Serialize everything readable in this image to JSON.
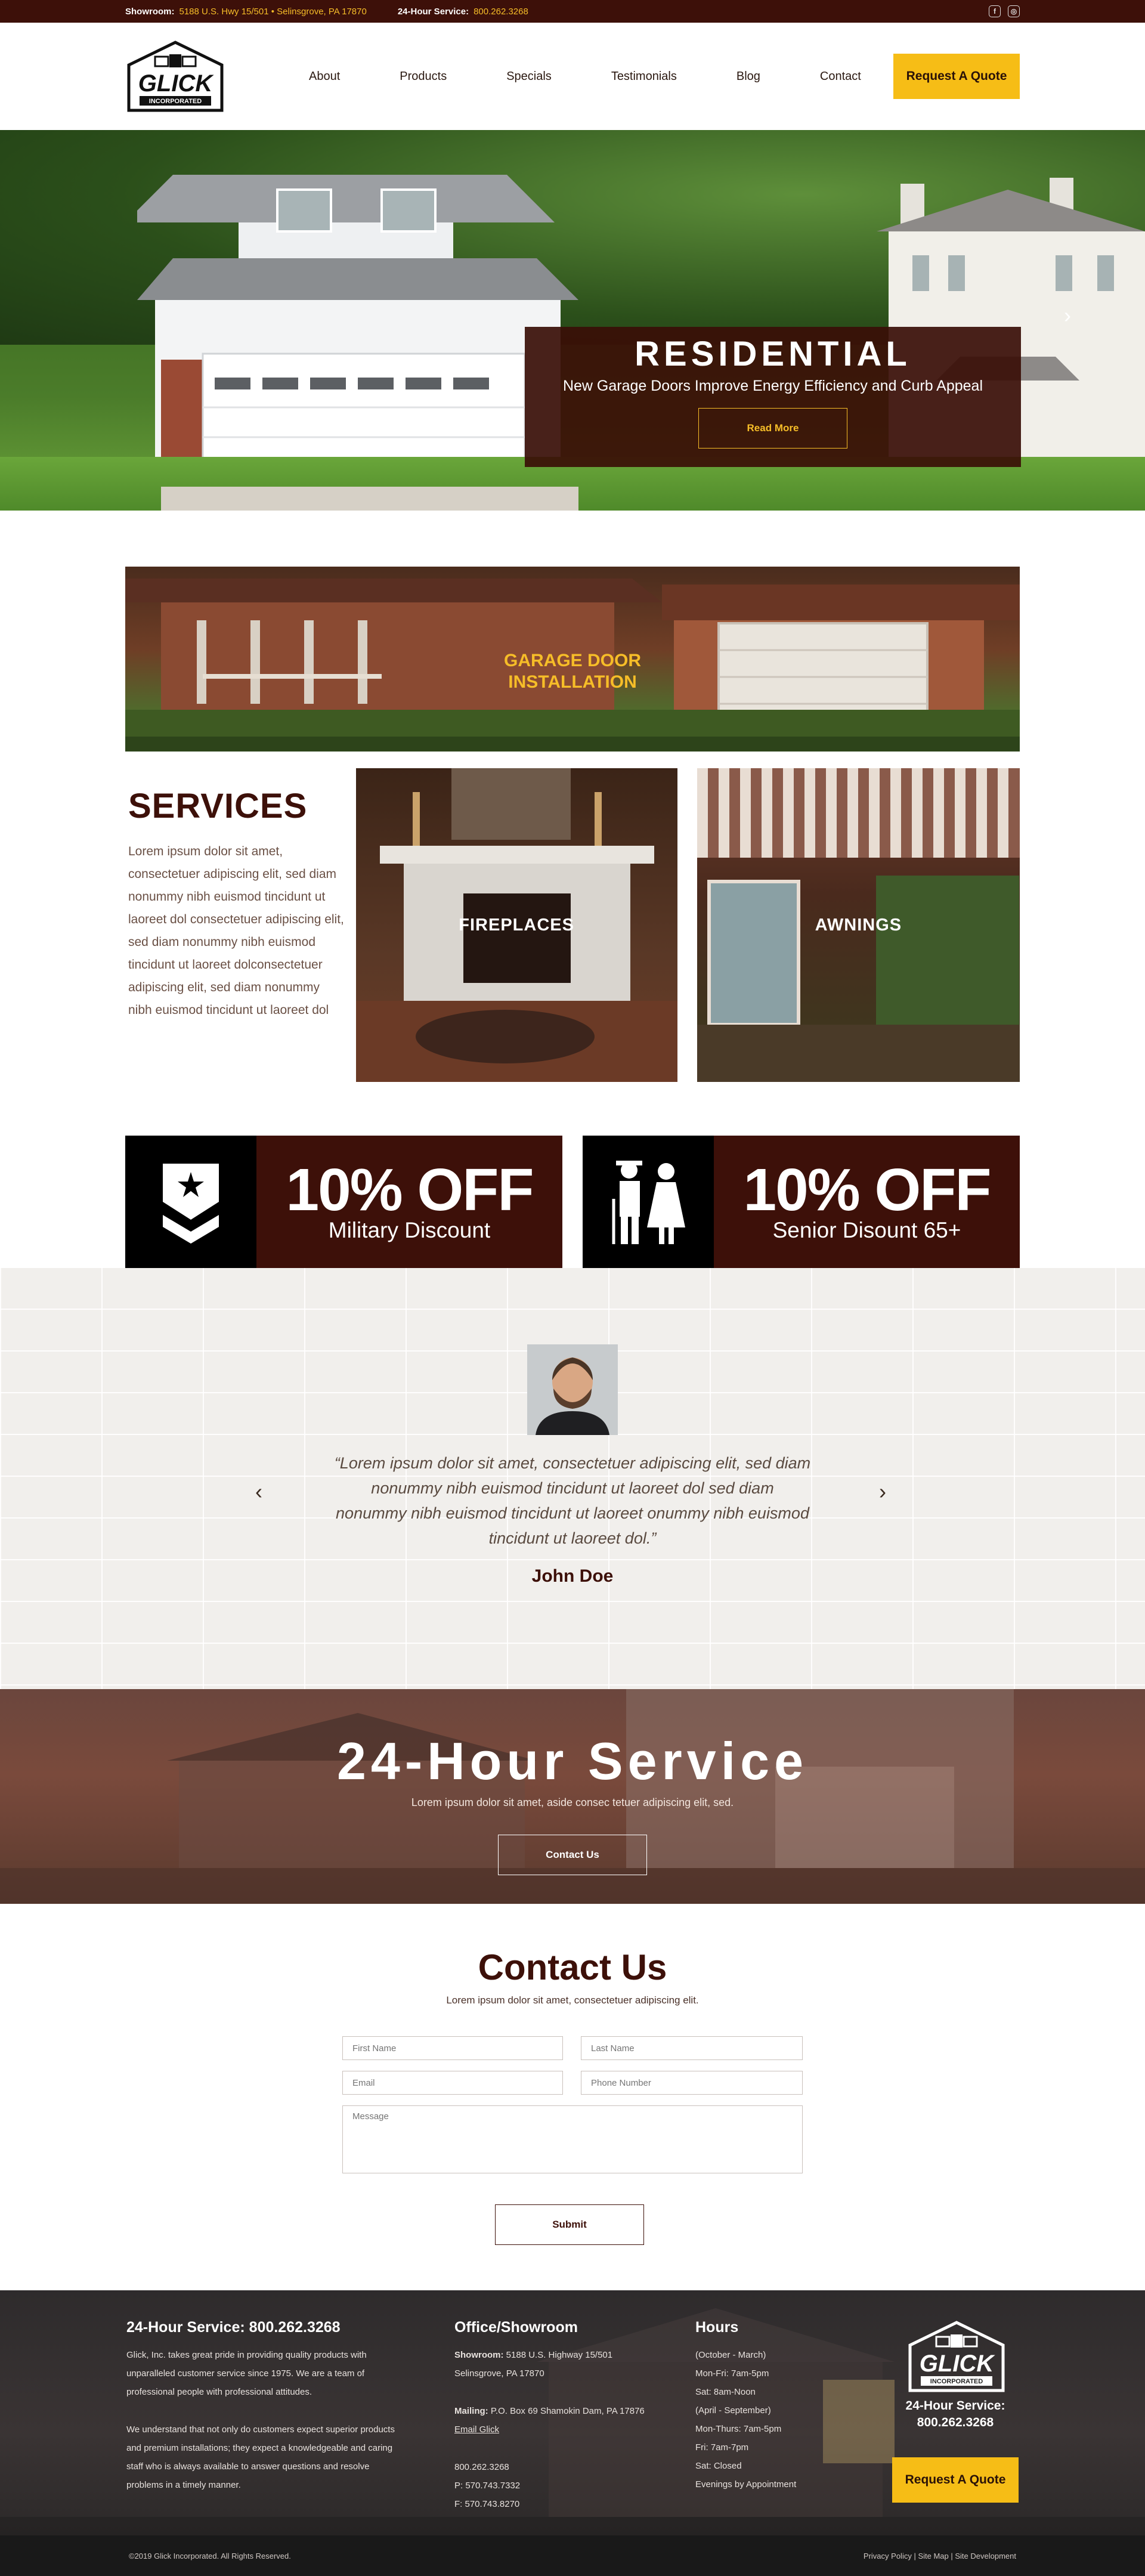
{
  "topbar": {
    "showroom_label": "Showroom:",
    "showroom_address": "5188 U.S. Hwy 15/501 • Selinsgrove, PA 17870",
    "service_label": "24-Hour Service:",
    "service_phone": "800.262.3268",
    "social": [
      {
        "icon": "facebook-icon",
        "glyph": "f"
      },
      {
        "icon": "instagram-icon",
        "glyph": "◎"
      }
    ]
  },
  "header": {
    "logo_text": "GLICK",
    "logo_sub": "INCORPORATED",
    "nav": [
      "About",
      "Products",
      "Specials",
      "Testimonials",
      "Blog",
      "Contact"
    ],
    "quote_button": "Request A Quote"
  },
  "hero": {
    "title": "RESIDENTIAL",
    "subtitle": "New Garage Doors Improve Energy Efficiency and Curb Appeal",
    "button": "Read More",
    "arrow": "›"
  },
  "install": {
    "line1": "GARAGE DOOR",
    "line2": "INSTALLATION"
  },
  "services": {
    "title": "SERVICES",
    "body": "Lorem ipsum dolor sit amet, consectetuer adipiscing elit, sed diam nonummy nibh euismod tincidunt ut laoreet dol consectetuer adipiscing elit, sed diam nonummy nibh euismod tincidunt ut laoreet dolconsectetuer adipiscing elit, sed diam nonummy nibh euismod tincidunt ut laoreet dol",
    "cards": [
      "FIREPLACES",
      "AWNINGS"
    ]
  },
  "discounts": [
    {
      "big": "10% OFF",
      "small": "Military Discount",
      "icon": "military-badge-icon"
    },
    {
      "big": "10% OFF",
      "small": "Senior Disount 65+",
      "icon": "senior-couple-icon"
    }
  ],
  "testimonial": {
    "quote": "“Lorem ipsum dolor sit amet, consectetuer adipiscing elit, sed diam nonummy nibh euismod tincidunt ut laoreet dol sed diam nonummy nibh euismod tincidunt ut laoreet onummy nibh euismod tincidunt ut laoreet dol.”",
    "author": "John Doe",
    "prev": "‹",
    "next": "›"
  },
  "service24": {
    "title": "24-Hour Service",
    "subtitle": "Lorem ipsum dolor sit amet, aside consec tetuer adipiscing elit, sed.",
    "button": "Contact Us"
  },
  "contact": {
    "title": "Contact Us",
    "subtitle": "Lorem ipsum dolor sit amet, consectetuer adipiscing elit.",
    "first_name": "First Name",
    "last_name": "Last Name",
    "email": "Email",
    "phone": "Phone Number",
    "message": "Message",
    "submit": "Submit"
  },
  "footer": {
    "col1_title": "24-Hour Service: 800.262.3268",
    "col1_p1": "Glick, Inc. takes great pride in providing quality products with unparalleled customer service since 1975. We are a team of professional people with professional attitudes.",
    "col1_p2": "We understand that not only do customers expect superior products and premium installations; they expect a knowledgeable and caring staff who is always available to answer questions and resolve problems in a timely manner.",
    "col2_title": "Office/Showroom",
    "showroom_label": "Showroom:",
    "showroom_line1": "5188 U.S. Highway 15/501",
    "showroom_line2": "Selinsgrove, PA 17870",
    "mailing_label": "Mailing:",
    "mailing_value": "P.O. Box 69 Shamokin Dam, PA 17876",
    "email_link": "Email Glick",
    "phone_main": "800.262.3268",
    "phone_p": "P: 570.743.7332",
    "phone_f": "F: 570.743.8270",
    "col3_title": "Hours",
    "hours": [
      "(October - March)",
      "Mon-Fri: 7am-5pm",
      "Sat: 8am-Noon",
      "(April - September)",
      "Mon-Thurs: 7am-5pm",
      "Fri: 7am-7pm",
      "Sat: Closed",
      "Evenings by Appointment"
    ],
    "service_label": "24-Hour Service:",
    "service_phone": "800.262.3268",
    "quote_button": "Request A Quote",
    "copyright": "©2019 Glick Incorporated. All Rights Reserved.",
    "links": [
      "Privacy Policy",
      "Site Map",
      "Site Development"
    ]
  },
  "colors": {
    "brand_dark": "#3d1009",
    "accent_gold": "#f6bd16"
  }
}
